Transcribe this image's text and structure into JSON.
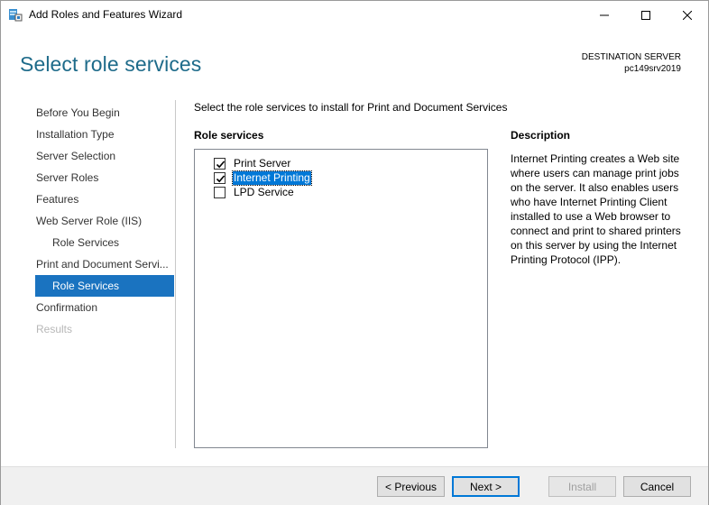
{
  "window": {
    "title": "Add Roles and Features Wizard",
    "icons": [
      "server-manager-icon",
      "minimize-icon",
      "maximize-icon",
      "close-icon"
    ]
  },
  "header": {
    "page_title": "Select role services",
    "destination_label": "DESTINATION SERVER",
    "destination_server": "pc149srv2019"
  },
  "nav": {
    "items": [
      {
        "label": "Before You Begin",
        "state": "normal"
      },
      {
        "label": "Installation Type",
        "state": "normal"
      },
      {
        "label": "Server Selection",
        "state": "normal"
      },
      {
        "label": "Server Roles",
        "state": "normal"
      },
      {
        "label": "Features",
        "state": "normal"
      },
      {
        "label": "Web Server Role (IIS)",
        "state": "normal"
      },
      {
        "label": "Role Services",
        "state": "sub"
      },
      {
        "label": "Print and Document Servi...",
        "state": "normal"
      },
      {
        "label": "Role Services",
        "state": "active"
      },
      {
        "label": "Confirmation",
        "state": "normal"
      },
      {
        "label": "Results",
        "state": "disabled"
      }
    ]
  },
  "main": {
    "instruction": "Select the role services to install for Print and Document Services",
    "role_services_heading": "Role services",
    "role_services": [
      {
        "label": "Print Server",
        "checked": true,
        "selected": false
      },
      {
        "label": "Internet Printing",
        "checked": true,
        "selected": true
      },
      {
        "label": "LPD Service",
        "checked": false,
        "selected": false
      }
    ],
    "description_heading": "Description",
    "description": "Internet Printing creates a Web site where users can manage print jobs on the server. It also enables users who have Internet Printing Client installed to use a Web browser to connect and print to shared printers on this server by using the Internet Printing Protocol (IPP)."
  },
  "footer": {
    "previous_label": "< Previous",
    "next_label": "Next >",
    "install_label": "Install",
    "cancel_label": "Cancel"
  },
  "colors": {
    "title_accent": "#1e6b8a",
    "nav_active": "#1a73c0",
    "selection": "#0078d7"
  }
}
